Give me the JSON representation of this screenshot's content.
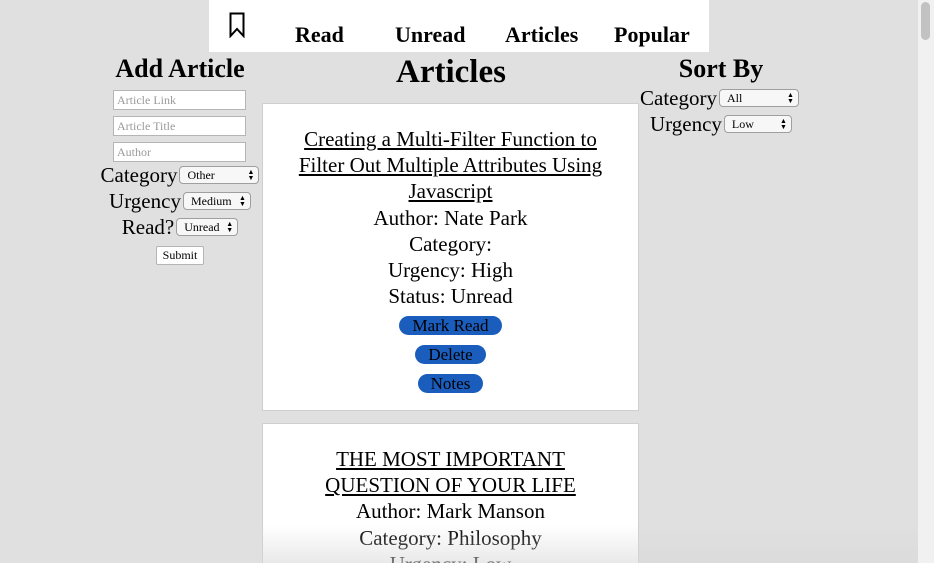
{
  "nav": {
    "links": [
      "Read",
      "Unread",
      "Articles",
      "Popular"
    ]
  },
  "add_article": {
    "title": "Add Article",
    "link_placeholder": "Article Link",
    "title_placeholder": "Article Title",
    "author_placeholder": "Author",
    "category_label": "Category",
    "category_value": "Other",
    "urgency_label": "Urgency",
    "urgency_value": "Medium",
    "read_label": "Read?",
    "read_value": "Unread",
    "submit_label": "Submit"
  },
  "main": {
    "heading": "Articles",
    "articles": [
      {
        "title": "Creating a Multi-Filter Function to Filter Out Multiple Attributes Using Javascript",
        "author": "Author: Nate Park",
        "category": "Category:",
        "urgency": "Urgency: High",
        "status": "Status: Unread",
        "mark_label": "Mark Read",
        "delete_label": "Delete",
        "notes_label": "Notes"
      },
      {
        "title": "THE MOST IMPORTANT QUESTION OF YOUR LIFE",
        "author": "Author: Mark Manson",
        "category": "Category: Philosophy",
        "urgency": "Urgency: Low"
      }
    ]
  },
  "sort_by": {
    "title": "Sort By",
    "category_label": "Category",
    "category_value": "All",
    "urgency_label": "Urgency",
    "urgency_value": "Low"
  },
  "icons": {
    "bookmark": "bookmark-icon",
    "select_arrows": "chevron-updown-icon"
  },
  "colors": {
    "background": "#e0e0e0",
    "card": "#ffffff",
    "button": "#1a5dbd"
  }
}
